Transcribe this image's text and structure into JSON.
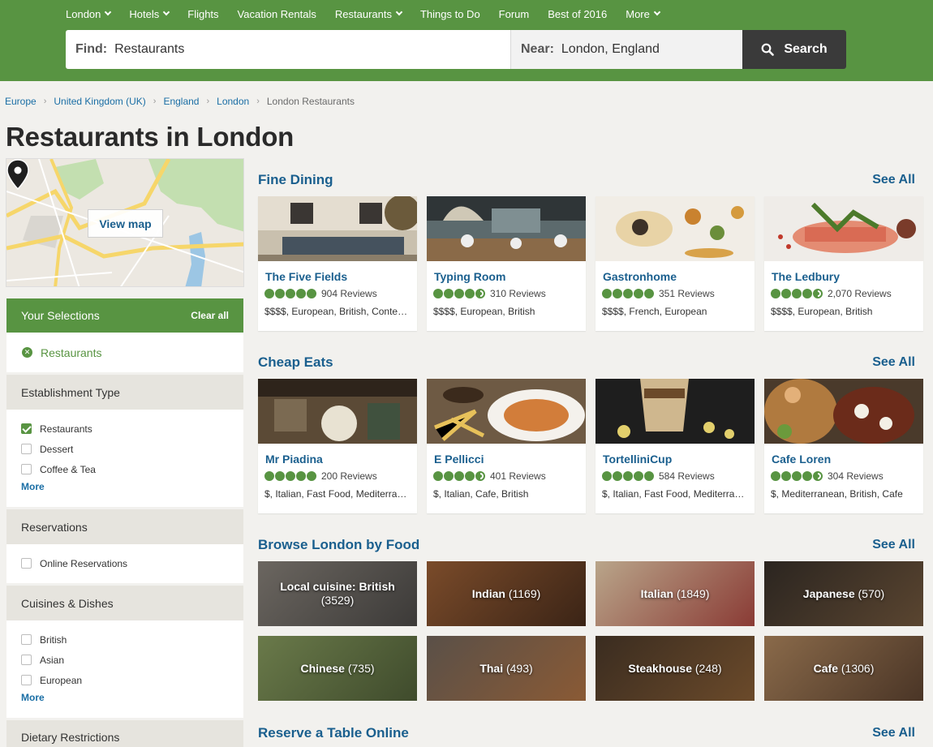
{
  "nav": [
    {
      "label": "London",
      "dropdown": true
    },
    {
      "label": "Hotels",
      "dropdown": true
    },
    {
      "label": "Flights",
      "dropdown": false
    },
    {
      "label": "Vacation Rentals",
      "dropdown": false
    },
    {
      "label": "Restaurants",
      "dropdown": true
    },
    {
      "label": "Things to Do",
      "dropdown": false
    },
    {
      "label": "Forum",
      "dropdown": false
    },
    {
      "label": "Best of 2016",
      "dropdown": false
    },
    {
      "label": "More",
      "dropdown": true
    }
  ],
  "search": {
    "find_label": "Find:",
    "find_value": "Restaurants",
    "near_label": "Near:",
    "near_value": "London, England",
    "button_label": "Search"
  },
  "breadcrumb": [
    "Europe",
    "United Kingdom (UK)",
    "England",
    "London"
  ],
  "breadcrumb_current": "London Restaurants",
  "page_title": "Restaurants in London",
  "map": {
    "view_label": "View map"
  },
  "selections": {
    "title": "Your Selections",
    "clear_label": "Clear all",
    "active": "Restaurants"
  },
  "filters": {
    "establishment": {
      "title": "Establishment Type",
      "options": [
        {
          "label": "Restaurants",
          "checked": true
        },
        {
          "label": "Dessert",
          "checked": false
        },
        {
          "label": "Coffee & Tea",
          "checked": false
        }
      ],
      "more": "More"
    },
    "reservations": {
      "title": "Reservations",
      "options": [
        {
          "label": "Online Reservations",
          "checked": false
        }
      ]
    },
    "cuisines": {
      "title": "Cuisines & Dishes",
      "options": [
        {
          "label": "British",
          "checked": false
        },
        {
          "label": "Asian",
          "checked": false
        },
        {
          "label": "European",
          "checked": false
        }
      ],
      "more": "More"
    },
    "dietary": {
      "title": "Dietary Restrictions"
    }
  },
  "see_all": "See All",
  "fine_dining": {
    "title": "Fine Dining",
    "cards": [
      {
        "name": "The Five Fields",
        "bubbles": 5,
        "reviews": "904 Reviews",
        "desc": "$$$$, European, British, Contemporary"
      },
      {
        "name": "Typing Room",
        "bubbles": 4.5,
        "reviews": "310 Reviews",
        "desc": "$$$$, European, British"
      },
      {
        "name": "Gastronhome",
        "bubbles": 5,
        "reviews": "351 Reviews",
        "desc": "$$$$, French, European"
      },
      {
        "name": "The Ledbury",
        "bubbles": 4.5,
        "reviews": "2,070 Reviews",
        "desc": "$$$$, European, British"
      }
    ]
  },
  "cheap_eats": {
    "title": "Cheap Eats",
    "cards": [
      {
        "name": "Mr Piadina",
        "bubbles": 5,
        "reviews": "200 Reviews",
        "desc": "$, Italian, Fast Food, Mediterranean"
      },
      {
        "name": "E Pellicci",
        "bubbles": 4.5,
        "reviews": "401 Reviews",
        "desc": "$, Italian, Cafe, British"
      },
      {
        "name": "TortelliniCup",
        "bubbles": 5,
        "reviews": "584 Reviews",
        "desc": "$, Italian, Fast Food, Mediterranean"
      },
      {
        "name": "Cafe Loren",
        "bubbles": 4.5,
        "reviews": "304 Reviews",
        "desc": "$, Mediterranean, British, Cafe"
      }
    ]
  },
  "browse": {
    "title": "Browse London by Food",
    "tiles": [
      {
        "name": "Local cuisine: British",
        "count": "(3529)"
      },
      {
        "name": "Indian",
        "count": "(1169)"
      },
      {
        "name": "Italian",
        "count": "(1849)"
      },
      {
        "name": "Japanese",
        "count": "(570)"
      },
      {
        "name": "Chinese",
        "count": "(735)"
      },
      {
        "name": "Thai",
        "count": "(493)"
      },
      {
        "name": "Steakhouse",
        "count": "(248)"
      },
      {
        "name": "Cafe",
        "count": "(1306)"
      }
    ]
  },
  "reserve": {
    "title": "Reserve a Table Online"
  },
  "colors": {
    "brand_green": "#589442",
    "link_blue": "#1a5f8e",
    "dark_button": "#3a3a3a"
  }
}
